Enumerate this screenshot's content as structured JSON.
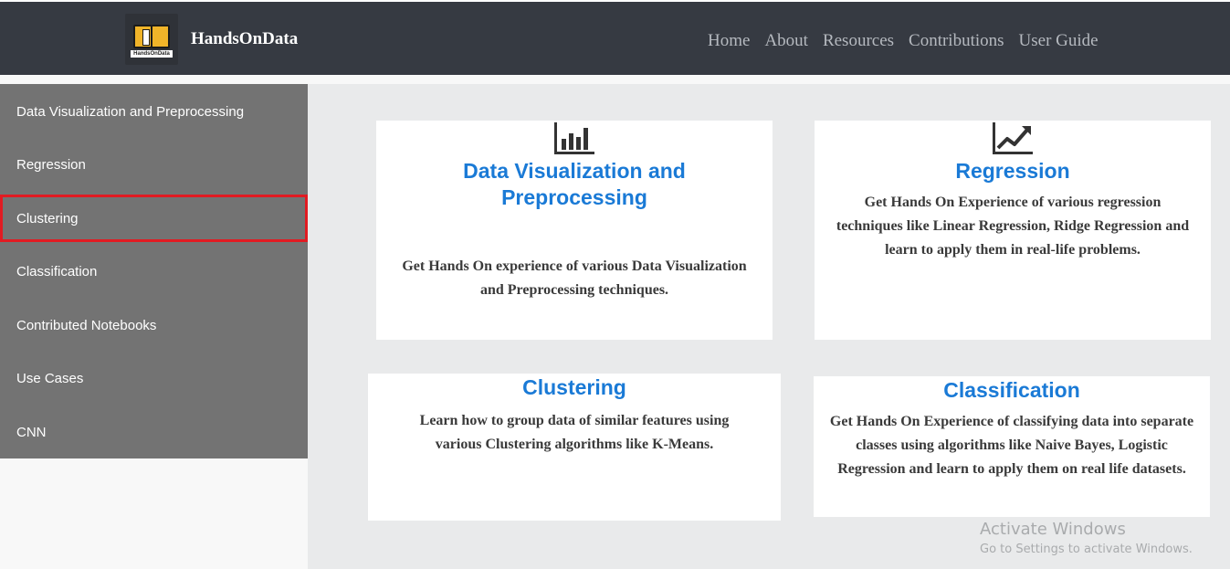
{
  "header": {
    "brand": "HandsOnData",
    "logo_text": "HandsOnData",
    "nav": [
      "Home",
      "About",
      "Resources",
      "Contributions",
      "User Guide"
    ]
  },
  "sidebar": {
    "items": [
      {
        "label": "Data Visualization and Preprocessing"
      },
      {
        "label": "Regression"
      },
      {
        "label": "Clustering",
        "selected": true
      },
      {
        "label": "Classification"
      },
      {
        "label": "Contributed Notebooks"
      },
      {
        "label": "Use Cases"
      },
      {
        "label": "CNN"
      }
    ]
  },
  "cards": [
    {
      "title": "Data Visualization and Preprocessing",
      "icon": "bar-chart-icon",
      "desc": "Get Hands On experience of various Data Visualization and Preprocessing techniques."
    },
    {
      "title": "Regression",
      "icon": "line-chart-icon",
      "desc": "Get Hands On Experience of various regression techniques like Linear Regression, Ridge Regression and learn to apply them in real-life problems."
    },
    {
      "title": "Clustering",
      "desc": "Learn how to group data of similar features using various Clustering algorithms like K-Means."
    },
    {
      "title": "Classification",
      "desc": "Get Hands On Experience of classifying data into separate classes using algorithms like Naive Bayes, Logistic Regression and learn to apply them on real life datasets."
    }
  ],
  "watermark": {
    "line1": "Activate Windows",
    "line2": "Go to Settings to activate Windows."
  },
  "colors": {
    "header_bg": "#363a42",
    "sidebar_bg": "#737373",
    "accent": "#1a7ad6",
    "selection": "#e11b22"
  }
}
